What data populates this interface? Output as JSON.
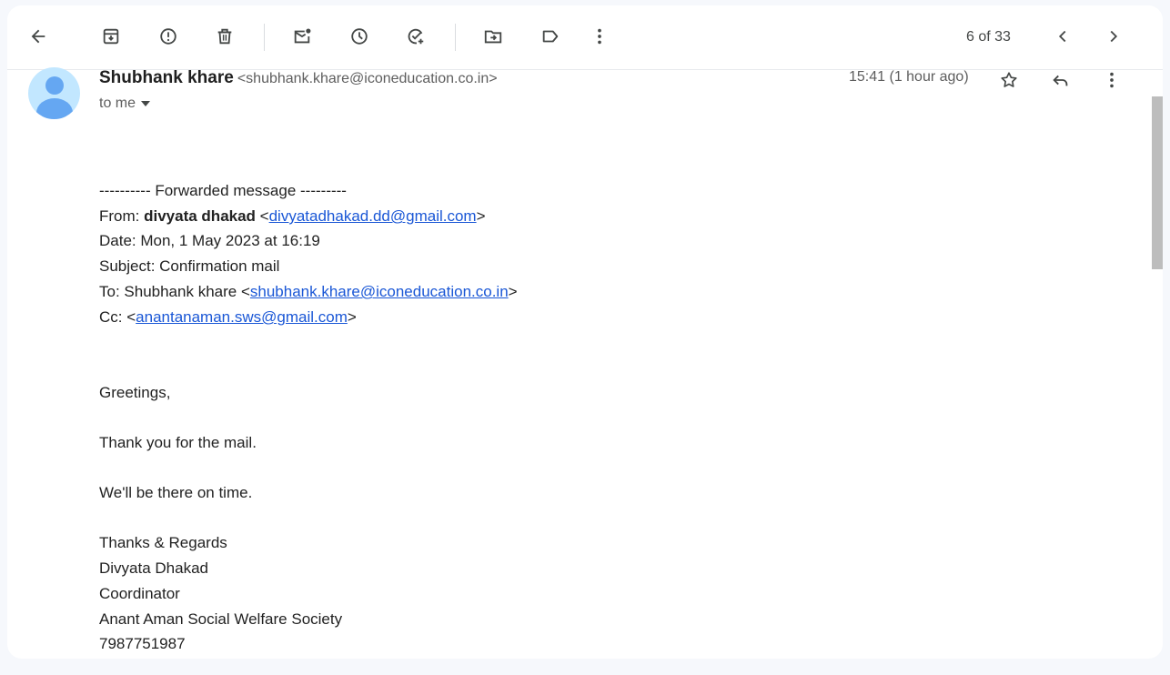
{
  "toolbar": {
    "icons": [
      "back-arrow-icon",
      "archive-icon",
      "report-spam-icon",
      "delete-icon",
      "mark-unread-icon",
      "snooze-icon",
      "add-to-tasks-icon",
      "move-to-icon",
      "label-icon",
      "more-vert-icon"
    ],
    "pager": "6 of 33"
  },
  "message": {
    "sender_name": "Shubhank khare",
    "sender_email": "<shubhank.khare@iconeducation.co.in>",
    "to": "to me",
    "timestamp": "15:41 (1 hour ago)"
  },
  "forward": {
    "header": "---------- Forwarded message ---------",
    "from_label": "From: ",
    "from_name": "divyata dhakad",
    "from_email": "divyatadhakad.dd@gmail.com",
    "date": "Date: Mon, 1 May 2023 at 16:19",
    "subject": "Subject: Confirmation mail",
    "to_label": "To: Shubhank khare <",
    "to_email": "shubhank.khare@iconeducation.co.in",
    "cc_label": "Cc: <",
    "cc_email": "anantanaman.sws@gmail.com"
  },
  "body": {
    "greeting": "Greetings,",
    "line1": "Thank you for the mail.",
    "line2": "We'll be there on time.",
    "signoff": "Thanks & Regards",
    "sig_name": "Divyata Dhakad",
    "sig_title": "Coordinator",
    "sig_org": "Anant Aman Social Welfare Society",
    "sig_phone": "7987751987"
  }
}
